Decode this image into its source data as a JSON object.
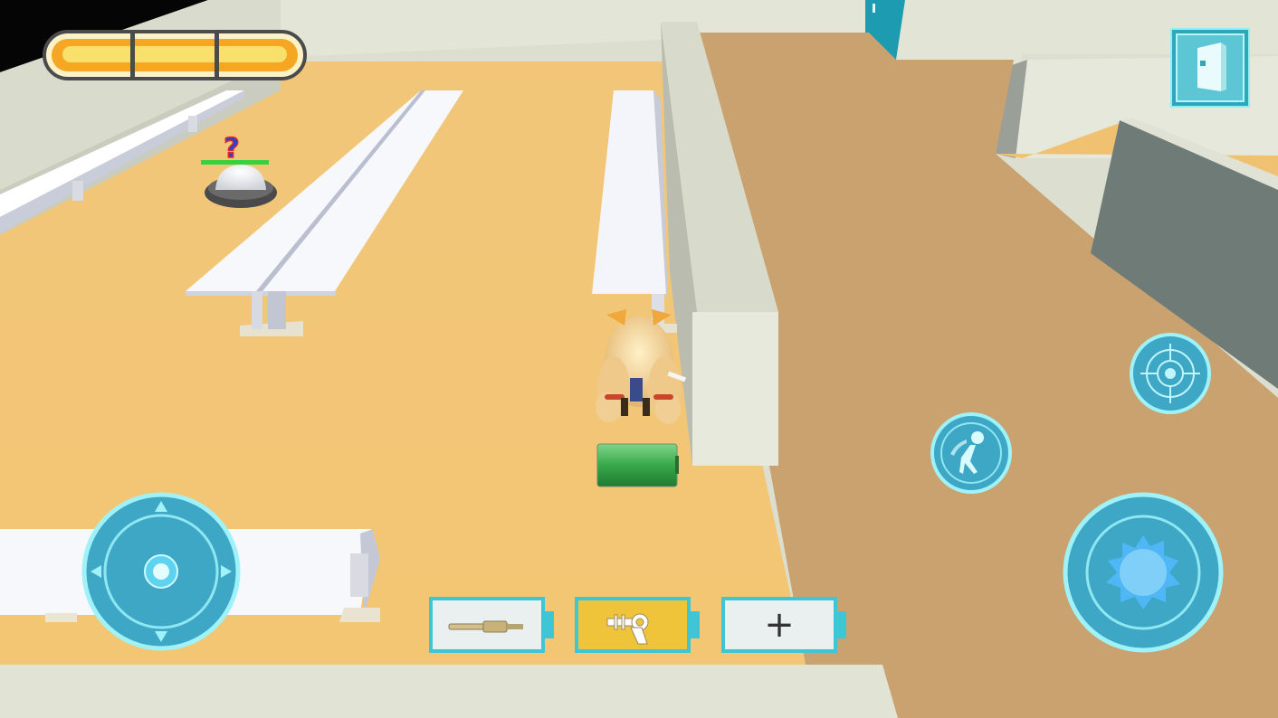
{
  "colors": {
    "floor": "#f0c477",
    "ramp": "#c9a26f",
    "wall": "#e4e6d8",
    "accent_cyan": "#7fe8f0",
    "health_fill": "#f9c74f",
    "battery_green": "#37a84a",
    "selected_slot": "#f0c43a"
  },
  "hud": {
    "health_segments": 3,
    "health_fraction": 1.0,
    "menu_icon": "door-icon",
    "joystick_icon": "dpad-joystick-icon",
    "aim_icon": "crosshair-icon",
    "dash_icon": "dash-runner-icon",
    "fire_icon": "blast-icon"
  },
  "weapon_slots": [
    {
      "icon": "rifle-icon",
      "selected": false
    },
    {
      "icon": "ray-gun-icon",
      "selected": true
    },
    {
      "icon": "plus-icon",
      "selected": false,
      "label": "+"
    }
  ],
  "world": {
    "enemy_marker": "?",
    "pickup": "battery-icon"
  }
}
